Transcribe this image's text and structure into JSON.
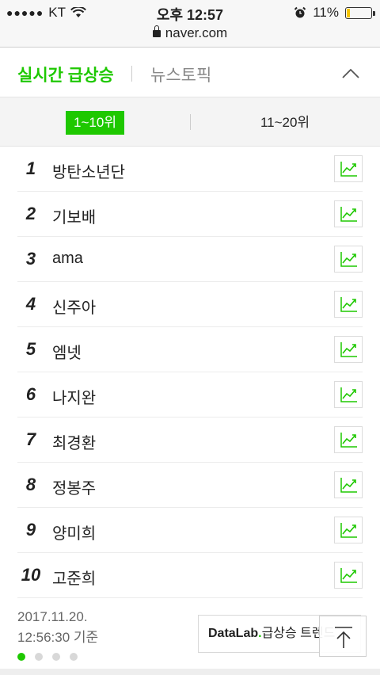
{
  "status": {
    "signal_dots": "●●●●●",
    "carrier": "KT",
    "time": "오후 12:57",
    "battery_percent": "11%",
    "battery_level": 0.11
  },
  "url": {
    "domain": "naver.com"
  },
  "header": {
    "tab_active": "실시간 급상승",
    "tab_other": "뉴스토픽"
  },
  "range": {
    "first": "1~10위",
    "second": "11~20위"
  },
  "items": [
    {
      "rank": "1",
      "keyword": "방탄소년단"
    },
    {
      "rank": "2",
      "keyword": "기보배"
    },
    {
      "rank": "3",
      "keyword": "ama"
    },
    {
      "rank": "4",
      "keyword": "신주아"
    },
    {
      "rank": "5",
      "keyword": "엠넷"
    },
    {
      "rank": "6",
      "keyword": "나지완"
    },
    {
      "rank": "7",
      "keyword": "최경환"
    },
    {
      "rank": "8",
      "keyword": "정봉주"
    },
    {
      "rank": "9",
      "keyword": "양미희"
    },
    {
      "rank": "10",
      "keyword": "고준희"
    }
  ],
  "footer": {
    "date": "2017.11.20.",
    "time": "12:56:30 기준",
    "datalab_brand": "DataLab",
    "datalab_dot": ".",
    "datalab_text": "급상승 트렌드"
  },
  "colors": {
    "accent": "#1ec800"
  }
}
